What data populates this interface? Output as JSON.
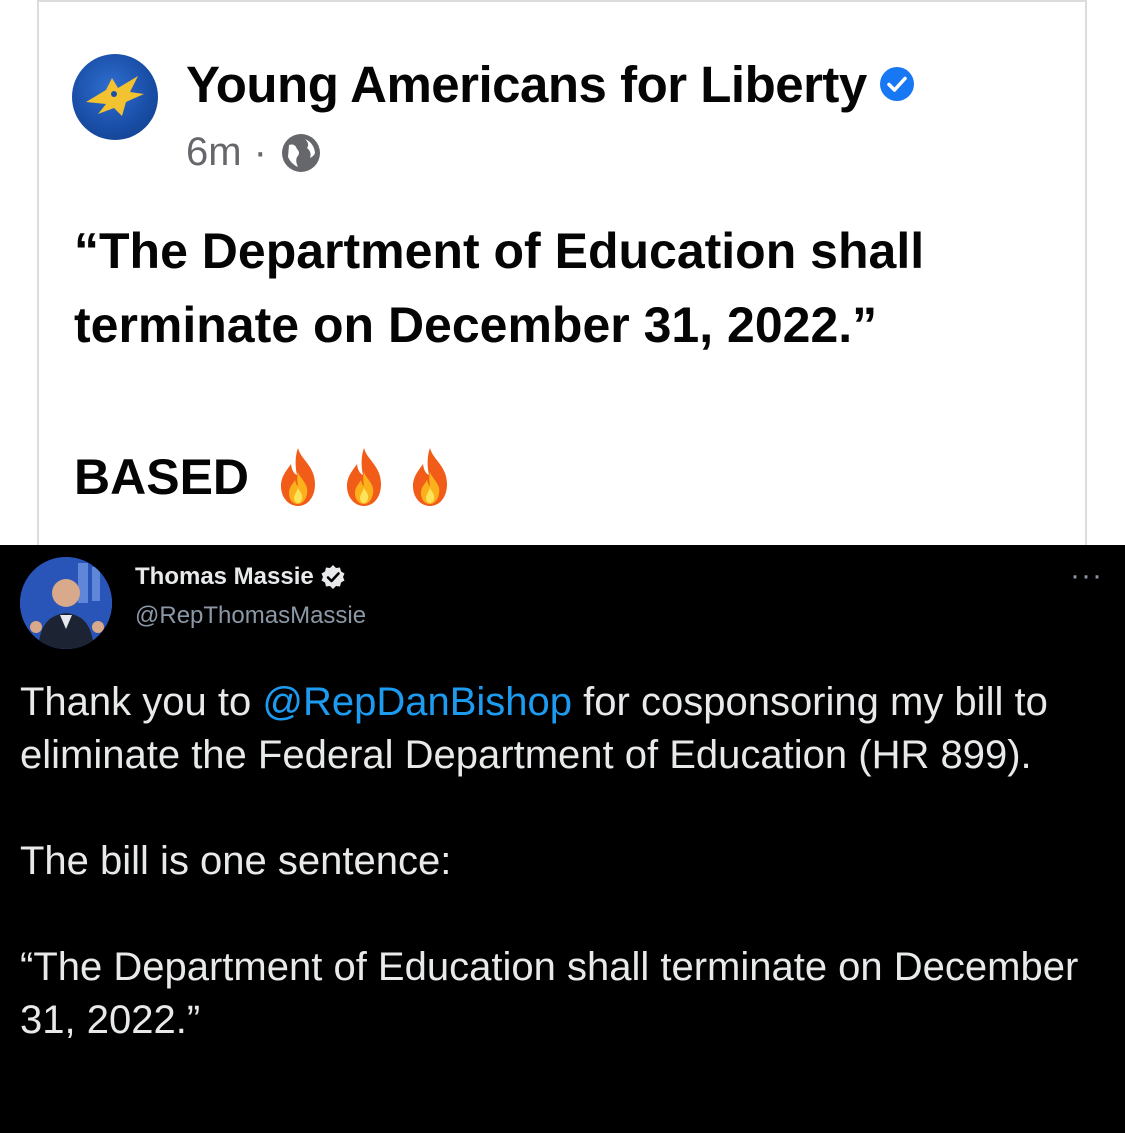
{
  "facebook_post": {
    "page_name": "Young Americans for Liberty",
    "time": "6m",
    "separator": "·",
    "text_quote": "“The Department of Education shall terminate on December 31, 2022.”",
    "text_reaction": "BASED",
    "reaction_emojis": [
      "fire-emoji",
      "fire-emoji",
      "fire-emoji"
    ],
    "verified_color": "#1877f2"
  },
  "tweet": {
    "display_name": "Thomas Massie",
    "handle": "@RepThomasMassie",
    "more_label": "···",
    "text_1_before": "Thank you to ",
    "mention": "@RepDanBishop",
    "text_1_after": " for cosponsoring my bill to eliminate the Federal Department of Education (HR 899).",
    "text_2": "The bill is one sentence:",
    "text_3": "“The Department of Education shall terminate on December 31, 2022.”",
    "mention_color": "#1d9bf0"
  }
}
